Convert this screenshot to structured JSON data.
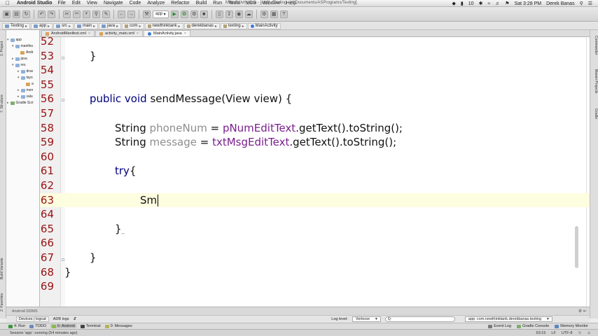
{
  "menubar": {
    "app_name": "Android Studio",
    "menus": [
      "File",
      "Edit",
      "View",
      "Navigate",
      "Code",
      "Analyze",
      "Refactor",
      "Build",
      "Run",
      "Tools",
      "VCS",
      "Window",
      "Help"
    ],
    "window_title": "MainActivity.java - [app] - Texting - [~/Documents/ASPrograms/Texting]",
    "battery_count": "10",
    "clock": "Sat 3:28 PM",
    "user": "Derek Banas"
  },
  "toolbar": {
    "run_config": "app"
  },
  "breadcrumb": {
    "items": [
      "Texting",
      "app",
      "src",
      "main",
      "java",
      "com",
      "newthinktank",
      "derekbanas",
      "texting",
      "MainActivity"
    ]
  },
  "project_tree": {
    "items": [
      "app",
      "manifes",
      "Andr",
      "java",
      "res",
      "drav",
      "layo",
      "a",
      "men",
      "valu",
      "Gradle Scri"
    ]
  },
  "left_tool_tabs": [
    "1: Project",
    "7: Structure",
    "Build Variants",
    "2: Favorites"
  ],
  "right_tool_tabs": [
    "Commander",
    "Maven Projects",
    "Gradle"
  ],
  "editor_tabs": [
    {
      "label": "AndroidManifest.xml",
      "active": false
    },
    {
      "label": "activity_main.xml",
      "active": false
    },
    {
      "label": "MainActivity.java",
      "active": true
    }
  ],
  "editor": {
    "lines": [
      {
        "num": "52",
        "text": ""
      },
      {
        "num": "53",
        "text": "    }"
      },
      {
        "num": "54",
        "text": ""
      },
      {
        "num": "55",
        "text": ""
      },
      {
        "num": "56",
        "text": "    public void sendMessage(View view) {"
      },
      {
        "num": "57",
        "text": ""
      },
      {
        "num": "58",
        "text": "        String phoneNum = pNumEditText.getText().toString();"
      },
      {
        "num": "59",
        "text": "        String message = txtMsgEditText.getText().toString();"
      },
      {
        "num": "60",
        "text": ""
      },
      {
        "num": "61",
        "text": "        try{"
      },
      {
        "num": "62",
        "text": ""
      },
      {
        "num": "63",
        "text": "            Sm"
      },
      {
        "num": "64",
        "text": ""
      },
      {
        "num": "65",
        "text": "        }"
      },
      {
        "num": "66",
        "text": ""
      },
      {
        "num": "67",
        "text": "    }"
      },
      {
        "num": "68",
        "text": "}"
      },
      {
        "num": "69",
        "text": ""
      }
    ],
    "current_line": "63",
    "tokens": {
      "l56_kw1": "public",
      "l56_kw2": "void",
      "l56_rest": " sendMessage(View view) {",
      "l58_type": "String",
      "l58_var": "phoneNum",
      "l58_eq": " = ",
      "l58_field": "pNumEditText",
      "l58_rest": ".getText().toString();",
      "l59_type": "String",
      "l59_var": "message",
      "l59_eq": " = ",
      "l59_field": "txtMsgEditText",
      "l59_rest": ".getText().toString();",
      "l61_kw": "try",
      "l61_rest": "{",
      "l63_text": "Sm",
      "l53_text": "}",
      "l65_text": "}",
      "l67_text": "}",
      "l68_text": "}"
    }
  },
  "ddms": {
    "title": "Android DDMS",
    "tab_devices": "Devices | logcat",
    "tab_adb": "ADB logs",
    "log_level_label": "Log level:",
    "log_level_value": "Verbose",
    "search_prefix": "Q-",
    "process": "app: com.newthinktank.derekbanas.texting"
  },
  "tool_tabs": {
    "left": [
      "4: Run",
      "TODO",
      "6: Android",
      "Terminal",
      "0: Messages"
    ],
    "right": [
      "Event Log",
      "Gradle Console",
      "Memory Monitor"
    ]
  },
  "status": {
    "message": "Session 'app': running (54 minutes ago)",
    "position": "63:15",
    "line_sep": "LF",
    "encoding": "UTF-8"
  },
  "colors": {
    "line_number": "#9a1010",
    "keyword": "#000080",
    "field": "#7a1f8e",
    "unused_variable": "#8e8e8e",
    "current_line_bg": "#fdfde0"
  }
}
